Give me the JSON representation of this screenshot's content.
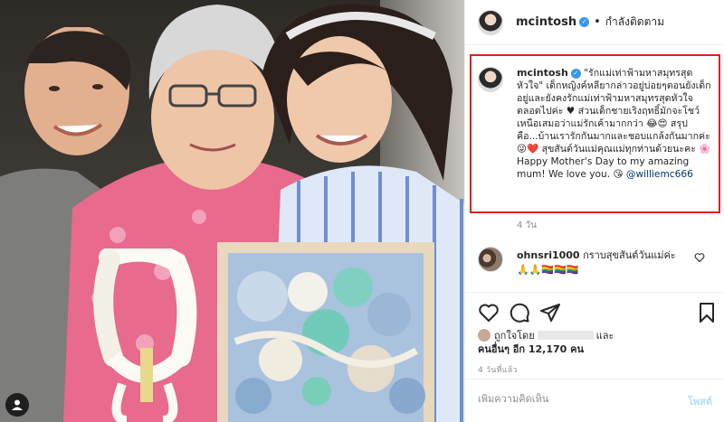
{
  "post": {
    "username": "mcintosh",
    "separator": "•",
    "follow_status": "กำลังติดตาม",
    "caption": {
      "username": "mcintosh",
      "text": "\"รักแม่เท่าฟ้ามหาสมุทรสุดหัวใจ\" เด็กหญิงค์หลียากล่าวอยู่บ่อยๆตอนยังเด็กอยู่และยังคงรักแม่เท่าฟ้ามหาสมุทรสุดหัวใจตลอดไปค่ะ ♥ ส่วนเด็กชายเริงฤทธิ์มักจะโชว์เหนือเสมอว่าแม่รักเค้ามากกว่า 😂😍 สรุปคือ...บ้านเรารักกันมากและชอบแกล้งกันมากค่ะ 😜❤️ สุขสันต์วันแม่คุณแม่ทุกท่านด้วยนะคะ 🌸 Happy Mother's Day to my amazing mum! We love you. 😘",
      "mention": "@williemc666",
      "age": "4 วัน"
    },
    "comment": {
      "username": "ohnsri1000",
      "text": "กราบสุขสันต์วันแม่ค่ะ 🙏🙏🏳️‍🌈🏳️‍🌈🏳️‍🌈"
    },
    "likes": {
      "prefix": "ถูกใจโดย",
      "middle": "และ",
      "label": "คนอื่นๆ อีก 12,170 คน"
    },
    "posted_ago": "4 วันที่แล้ว",
    "composer": {
      "placeholder": "เพิ่มความคิดเห็น",
      "post_label": "โพสต์"
    }
  },
  "icons": {
    "verified": "verified-badge-icon",
    "like": "heart-icon",
    "comment": "comment-icon",
    "share": "share-icon",
    "save": "bookmark-icon",
    "user_tag": "user-tag-icon"
  },
  "colors": {
    "highlight_box": "#e02020",
    "verified": "#3897f0",
    "mention": "#00376b",
    "post_button_disabled": "#b2dffc"
  }
}
